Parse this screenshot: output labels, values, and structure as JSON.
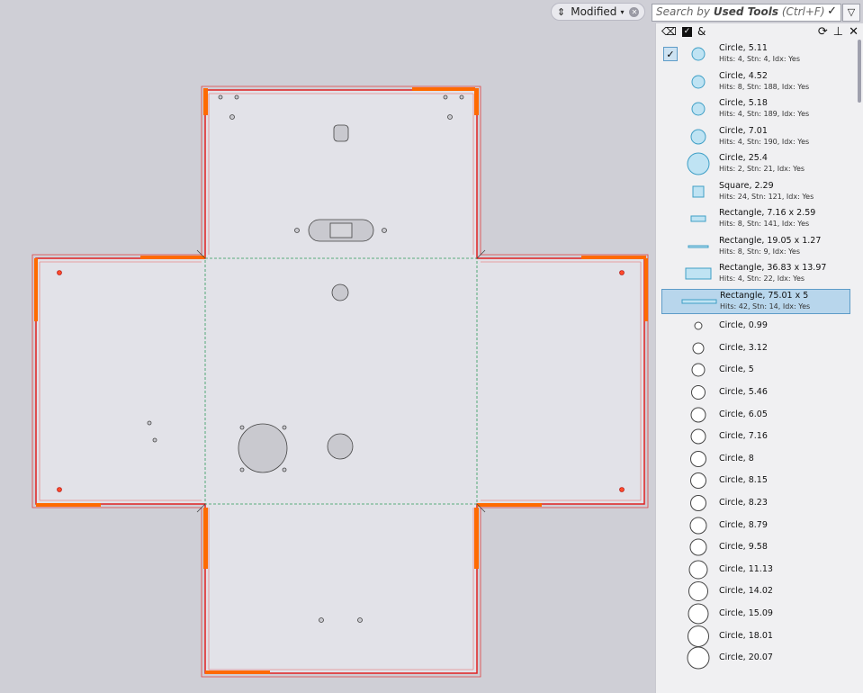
{
  "filter": {
    "label": "Modified",
    "sort_icon": "sort-icon",
    "drop": "▾"
  },
  "search": {
    "prefix": "Search by ",
    "bold": "Used Tools",
    "suffix": " (Ctrl+F)",
    "ok": "✓"
  },
  "panel": {
    "amp": "&",
    "refresh": "⟳",
    "pin": "📌",
    "close": "✕",
    "check": "✓"
  },
  "tools": [
    {
      "title": "Circle, 5.11",
      "sub": "Hits: 4, Stn: 4, Idx: Yes",
      "shape": "circle",
      "size": 7,
      "used": true,
      "checked": true
    },
    {
      "title": "Circle, 4.52",
      "sub": "Hits: 8, Stn: 188, Idx: Yes",
      "shape": "circle",
      "size": 7,
      "used": true
    },
    {
      "title": "Circle, 5.18",
      "sub": "Hits: 4, Stn: 189, Idx: Yes",
      "shape": "circle",
      "size": 7,
      "used": true
    },
    {
      "title": "Circle, 7.01",
      "sub": "Hits: 4, Stn: 190, Idx: Yes",
      "shape": "circle",
      "size": 8,
      "used": true
    },
    {
      "title": "Circle, 25.4",
      "sub": "Hits: 2, Stn: 21, Idx: Yes",
      "shape": "circle",
      "size": 12,
      "used": true
    },
    {
      "title": "Square, 2.29",
      "sub": "Hits: 24, Stn: 121, Idx: Yes",
      "shape": "square",
      "size": 6,
      "used": true
    },
    {
      "title": "Rectangle, 7.16 x 2.59",
      "sub": "Hits: 8, Stn: 141, Idx: Yes",
      "shape": "rect-small",
      "used": true
    },
    {
      "title": "Rectangle, 19.05 x 1.27",
      "sub": "Hits: 8, Stn: 9, Idx: Yes",
      "shape": "line",
      "used": true
    },
    {
      "title": "Rectangle, 36.83 x 13.97",
      "sub": "Hits: 4, Stn: 22, Idx: Yes",
      "shape": "rect-big",
      "used": true
    },
    {
      "title": "Rectangle, 75.01 x 5",
      "sub": "Hits: 42, Stn: 14, Idx: Yes",
      "shape": "rect-long",
      "used": true,
      "selected": true
    },
    {
      "title": "Circle, 0.99",
      "shape": "circle",
      "size": 4
    },
    {
      "title": "Circle, 3.12",
      "shape": "circle",
      "size": 6
    },
    {
      "title": "Circle, 5",
      "shape": "circle",
      "size": 7
    },
    {
      "title": "Circle, 5.46",
      "shape": "circle",
      "size": 7.5
    },
    {
      "title": "Circle, 6.05",
      "shape": "circle",
      "size": 8
    },
    {
      "title": "Circle, 7.16",
      "shape": "circle",
      "size": 8
    },
    {
      "title": "Circle, 8",
      "shape": "circle",
      "size": 8.5
    },
    {
      "title": "Circle, 8.15",
      "shape": "circle",
      "size": 8.5
    },
    {
      "title": "Circle, 8.23",
      "shape": "circle",
      "size": 8.5
    },
    {
      "title": "Circle, 8.79",
      "shape": "circle",
      "size": 9
    },
    {
      "title": "Circle, 9.58",
      "shape": "circle",
      "size": 9
    },
    {
      "title": "Circle, 11.13",
      "shape": "circle",
      "size": 10
    },
    {
      "title": "Circle, 14.02",
      "shape": "circle",
      "size": 10.5
    },
    {
      "title": "Circle, 15.09",
      "shape": "circle",
      "size": 11
    },
    {
      "title": "Circle, 18.01",
      "shape": "circle",
      "size": 11.5
    },
    {
      "title": "Circle, 20.07",
      "shape": "circle",
      "size": 12
    }
  ],
  "colors": {
    "panel_fill": "#e2e2e8",
    "outline_red": "#e02020",
    "tab_orange": "#ff6a00",
    "bend_green": "#2e9a5a",
    "tool_used": "#bfe3f3",
    "tool_used_stroke": "#3f9fc6"
  }
}
